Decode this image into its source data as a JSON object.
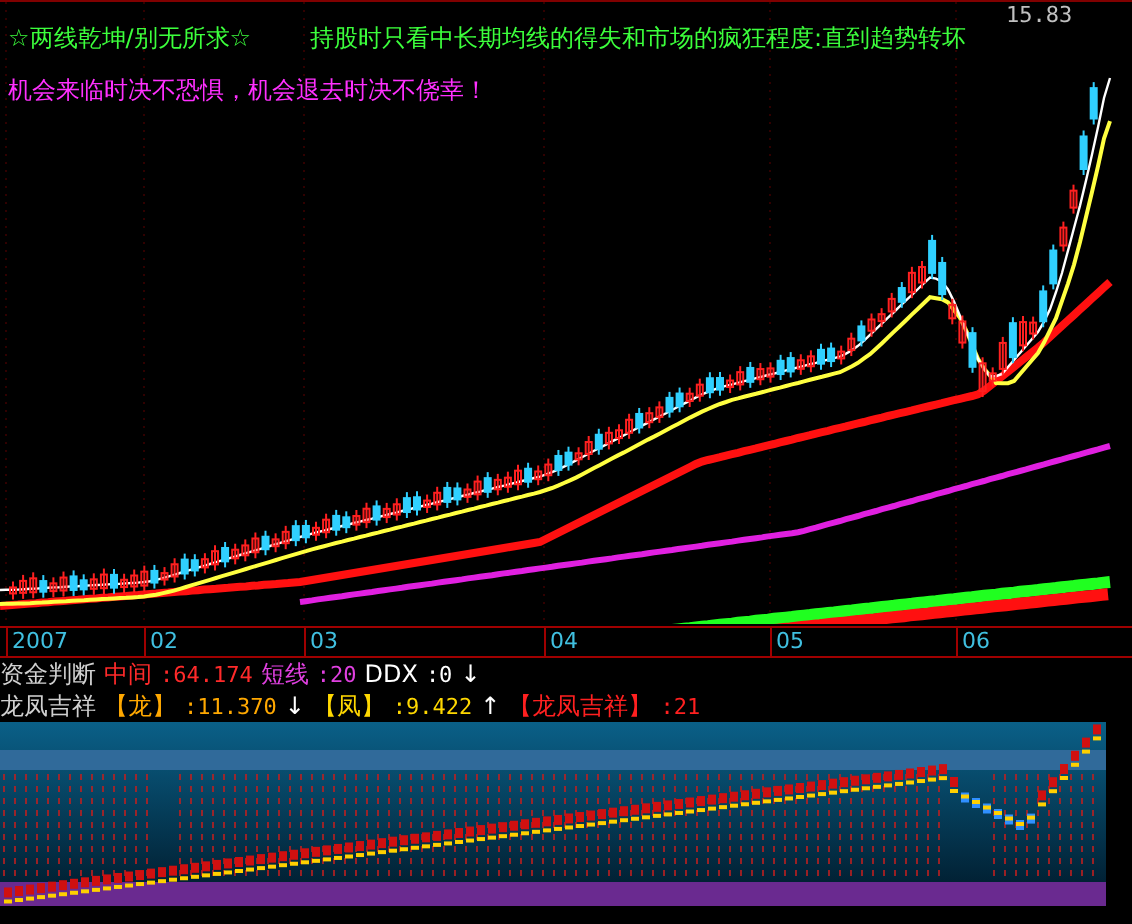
{
  "main_chart": {
    "title_left": "☆两线乾坤/别无所求☆",
    "title_right": "持股时只看中长期均线的得失和市场的疯狂程度:直到趋势转坏",
    "slogan": "机会来临时决不恐惧，机会退去时决不侥幸！",
    "price_label": "15.83"
  },
  "x_axis": {
    "labels": [
      "2007",
      "02",
      "03",
      "04",
      "05",
      "06"
    ]
  },
  "indicator_1": {
    "name": "资金判断",
    "items": [
      {
        "label": "中间",
        "value": ":64.174",
        "color": "#ff2a2a"
      },
      {
        "label": "短线",
        "value": ":20",
        "color": "#e040e0"
      },
      {
        "label": "DDX",
        "value": ":0",
        "arrow": "↓",
        "color": "#ffffff"
      }
    ]
  },
  "indicator_2": {
    "name": "龙凤吉祥",
    "items": [
      {
        "label": "【龙】",
        "value": ":11.370",
        "arrow": "↓",
        "color": "#ffa800"
      },
      {
        "label": "【凤】",
        "value": ":9.422",
        "arrow": "↑",
        "color": "#ffd800"
      },
      {
        "label": "【龙凤吉祥】",
        "value": ":21",
        "color": "#ff2020"
      }
    ]
  }
}
